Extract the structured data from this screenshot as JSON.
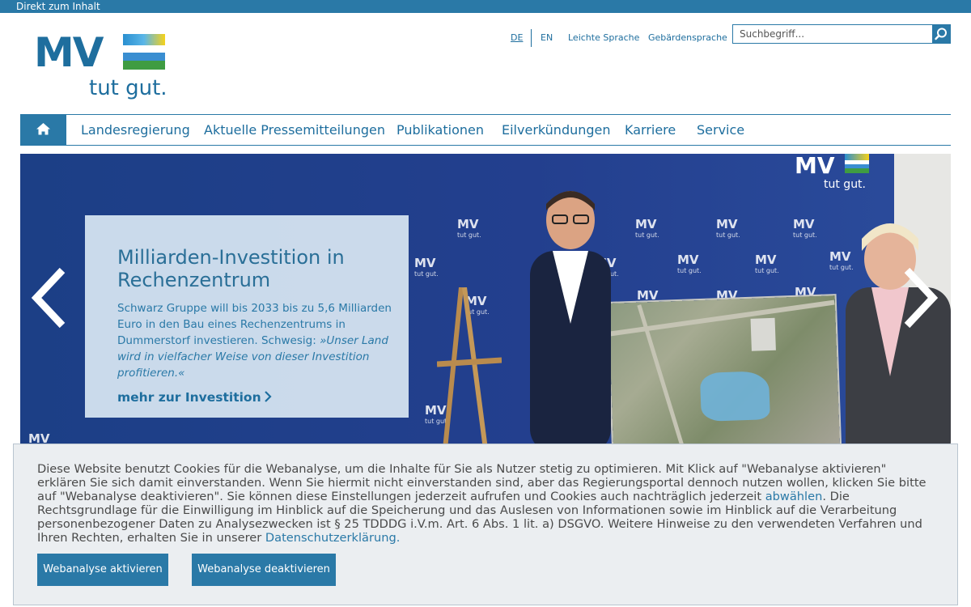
{
  "skip_link": "Direkt zum Inhalt",
  "logo": {
    "mark": "MV",
    "claim": "tut gut."
  },
  "metanav": {
    "de": "DE",
    "en": "EN",
    "leichte_sprache": "Leichte Sprache",
    "gebaerdensprache": "Gebärdensprache"
  },
  "search": {
    "placeholder": "Suchbegriff...",
    "icon": "search-icon"
  },
  "mainnav": {
    "home_icon": "home-icon",
    "items": [
      {
        "label": "Landesregierung"
      },
      {
        "label": "Aktuelle Pressemitteilungen"
      },
      {
        "label": "Publikationen"
      },
      {
        "label": "Eilverkündungen"
      },
      {
        "label": "Karriere"
      },
      {
        "label": "Service"
      }
    ]
  },
  "hero": {
    "title": "Milliarden-Investition in Rechenzentrum",
    "text_plain": "Schwarz Gruppe will bis 2033 bis zu 5,6 Milliarden Euro in den Bau eines Rechen­zentrums in Dummerstorf investieren. Schwesig: ",
    "text_quote": "»Unser Land wird in vielfacher Weise von dieser Investition profitieren.«",
    "link": "mehr zur Investition",
    "prev_icon": "chevron-left-icon",
    "next_icon": "chevron-right-icon",
    "wall_mark": "MV",
    "wall_claim": "tut gut."
  },
  "cookie": {
    "text_1": "Diese Website benutzt Cookies für die Webanalyse, um die Inhalte für Sie als Nutzer stetig zu optimieren. Mit Klick auf \"Webanalyse aktivieren\" erklären Sie sich damit einverstanden. Wenn Sie hiermit nicht einverstanden sind, aber das Regierungsportal dennoch nutzen wollen, klicken Sie bitte auf \"Webanalyse deaktivieren\". Sie können diese Einstellungen jederzeit aufrufen und Cookies auch nachträglich jederzeit ",
    "link_1": "abwählen",
    "text_2": ". Die Rechtsgrundlage für die Einwilligung im Hinblick auf die Speicherung und das Auslesen von Informationen sowie im Hinblick auf die Verarbeitung personenbezogener Daten zu Analysezwecken ist § 25 TDDDG i.V.m. Art. 6 Abs. 1 lit. a) DSGVO. Weitere Hinweise zu den verwendeten Verfahren und Ihren Rechten, erhalten Sie in unserer ",
    "link_2": "Datenschutzerklärung.",
    "btn_activate": "Webanalyse aktivieren",
    "btn_deactivate": "Webanalyse deaktivieren"
  },
  "colors": {
    "brand_blue": "#2a79a7",
    "hero_bg": "#233f8e",
    "cookie_bg": "#ebeef1"
  }
}
